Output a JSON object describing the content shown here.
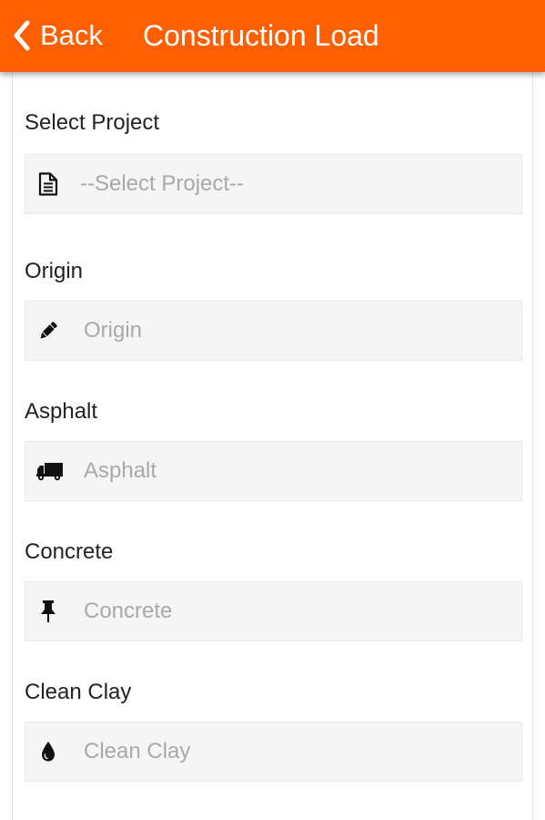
{
  "header": {
    "back_label": "Back",
    "title": "Construction Load",
    "back_icon": "chevron-left-icon",
    "background_color": "#fe5f00"
  },
  "form": {
    "fields": [
      {
        "label": "Select Project",
        "placeholder": "--Select Project--",
        "icon": "document-icon"
      },
      {
        "label": "Origin",
        "placeholder": "Origin",
        "icon": "pencil-icon"
      },
      {
        "label": "Asphalt",
        "placeholder": "Asphalt",
        "icon": "truck-icon"
      },
      {
        "label": "Concrete",
        "placeholder": "Concrete",
        "icon": "pushpin-icon"
      },
      {
        "label": "Clean Clay",
        "placeholder": "Clean Clay",
        "icon": "droplet-icon"
      }
    ]
  }
}
